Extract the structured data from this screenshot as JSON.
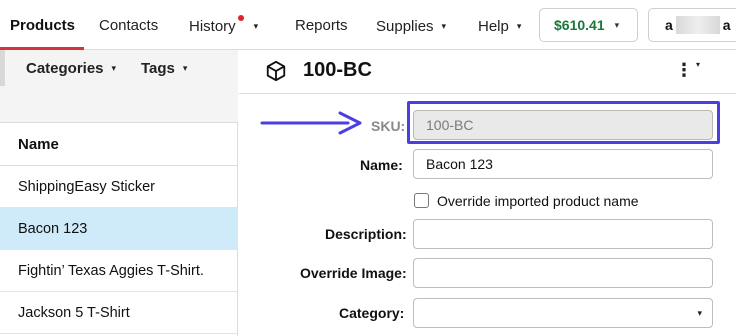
{
  "nav": {
    "products": "Products",
    "contacts": "Contacts",
    "history": "History",
    "reports": "Reports",
    "supplies": "Supplies",
    "help": "Help",
    "caret": "▾",
    "balance": "$610.41",
    "account_start": "a",
    "account_end": "a"
  },
  "colors": {
    "accent_red": "#d6333a",
    "balance_green": "#18793a",
    "highlight_blue": "#4a3fe0",
    "selected_row": "#cfeaf8"
  },
  "sidebar": {
    "categories_label": "Categories",
    "tags_label": "Tags",
    "column_header": "Name",
    "items": [
      {
        "label": "ShippingEasy Sticker"
      },
      {
        "label": "Bacon 123"
      },
      {
        "label": "Fightin’ Texas Aggies T-Shirt."
      },
      {
        "label": "Jackson 5 T-Shirt"
      }
    ]
  },
  "product": {
    "icon": "box-icon",
    "title": "100-BC",
    "menu_glyph": "⋮",
    "menu_caret": "▾"
  },
  "form": {
    "sku_label": "SKU:",
    "sku_value": "100-BC",
    "name_label": "Name:",
    "name_value": "Bacon 123",
    "override_name_label": "Override imported product name",
    "description_label": "Description:",
    "description_value": "",
    "override_image_label": "Override Image:",
    "override_image_value": "",
    "category_label": "Category:",
    "category_value": "",
    "select_caret": "▾"
  }
}
